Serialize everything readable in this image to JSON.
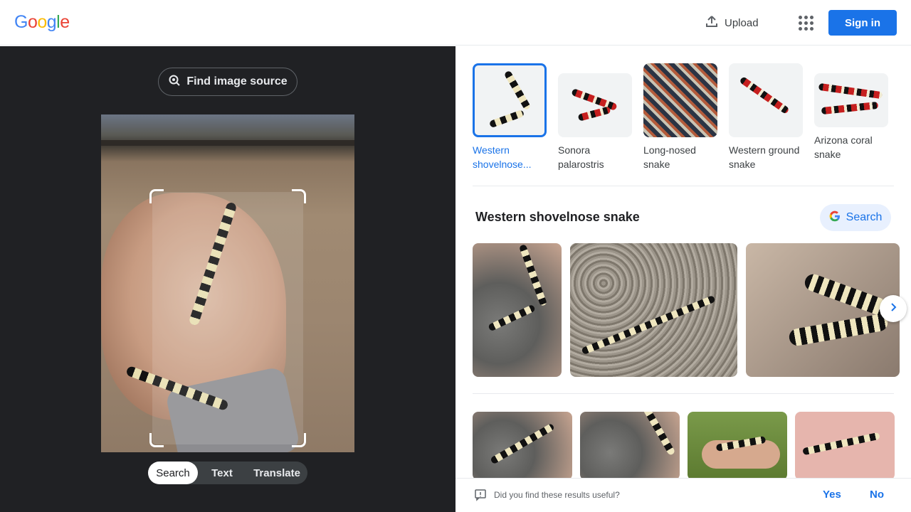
{
  "header": {
    "logo_text": "Google",
    "upload_label": "Upload",
    "signin_label": "Sign in"
  },
  "left": {
    "find_source_label": "Find image source",
    "modes": [
      "Search",
      "Text",
      "Translate"
    ],
    "active_mode": "Search"
  },
  "matches": [
    {
      "label": "Western shovelnose...",
      "selected": true
    },
    {
      "label": "Sonora palarostris",
      "selected": false
    },
    {
      "label": "Long-nosed snake",
      "selected": false
    },
    {
      "label": "Western ground snake",
      "selected": false
    },
    {
      "label": "Arizona coral snake",
      "selected": false
    }
  ],
  "section": {
    "title": "Western shovelnose snake",
    "search_label": "Search"
  },
  "feedback": {
    "question": "Did you find these results useful?",
    "yes": "Yes",
    "no": "No"
  },
  "colors": {
    "accent": "#1a73e8",
    "dark_pane": "#202124"
  }
}
